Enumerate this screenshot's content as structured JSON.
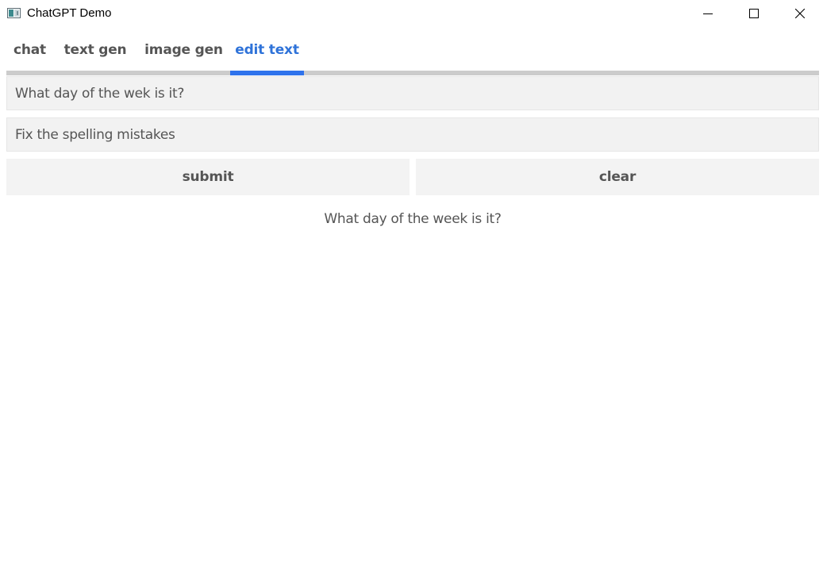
{
  "window": {
    "title": "ChatGPT Demo",
    "icon": "app-window-icon",
    "controls": [
      "minimize-icon",
      "maximize-icon",
      "close-icon"
    ]
  },
  "tabs": [
    {
      "label": "chat",
      "active": false
    },
    {
      "label": "text gen",
      "active": false
    },
    {
      "label": "image gen",
      "active": false
    },
    {
      "label": "edit text",
      "active": true
    }
  ],
  "form": {
    "input_value": "What day of the wek is it?",
    "instruction_value": "Fix the spelling mistakes",
    "submit_label": "submit",
    "clear_label": "clear"
  },
  "output": {
    "text": "What day of the week is it?"
  },
  "colors": {
    "accent": "#2f73ec",
    "accent_text": "#2f73d9",
    "text": "#555555",
    "field_bg": "#f2f2f2",
    "tab_track": "#cccccc"
  }
}
